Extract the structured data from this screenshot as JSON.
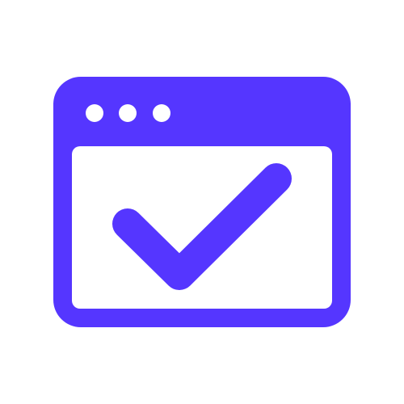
{
  "icon": {
    "name": "browser-window-checkmark-icon",
    "accent_color": "#5536FF",
    "background_color": "#FFFFFF",
    "window_controls": [
      "dot",
      "dot",
      "dot"
    ]
  }
}
